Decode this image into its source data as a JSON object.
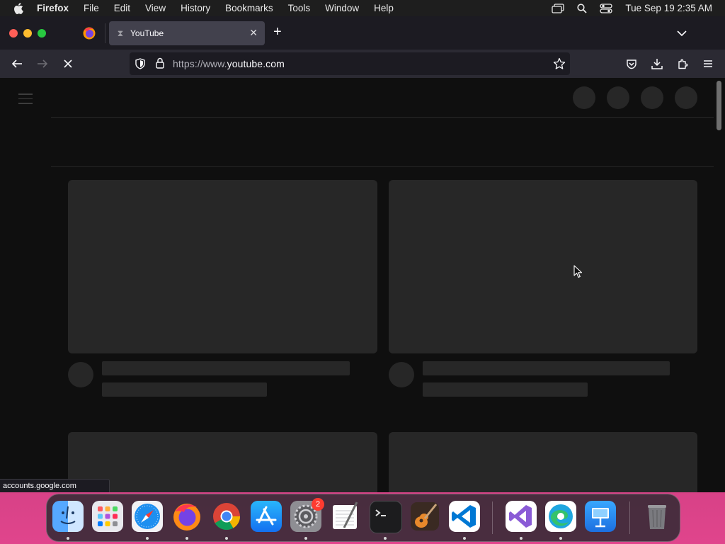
{
  "menubar": {
    "app_name": "Firefox",
    "menus": [
      "File",
      "Edit",
      "View",
      "History",
      "Bookmarks",
      "Tools",
      "Window",
      "Help"
    ],
    "clock": "Tue Sep 19  2:35 AM"
  },
  "tabs": {
    "active_tab_title": "YouTube",
    "active_tab_icon": "hourglass-loading-icon",
    "close_glyph": "✕",
    "new_tab_glyph": "+"
  },
  "urlbar": {
    "url_prefix": "https://www.",
    "url_domain": "youtube.com"
  },
  "status": {
    "link_preview": "accounts.google.com"
  },
  "dock": {
    "notification_badge": "2",
    "apps": [
      "Finder",
      "Launchpad",
      "Safari",
      "Firefox",
      "Google Chrome",
      "App Store",
      "System Settings",
      "TextEdit",
      "Terminal",
      "GarageBand",
      "Visual Studio Code",
      "Visual Studio",
      "Microsoft Edge",
      "Keynote",
      "Trash"
    ]
  },
  "colors": {
    "browser_chrome": "#1c1b22",
    "toolbar": "#2b2a33",
    "page_background": "#0f0f0f",
    "skeleton": "#272727"
  }
}
